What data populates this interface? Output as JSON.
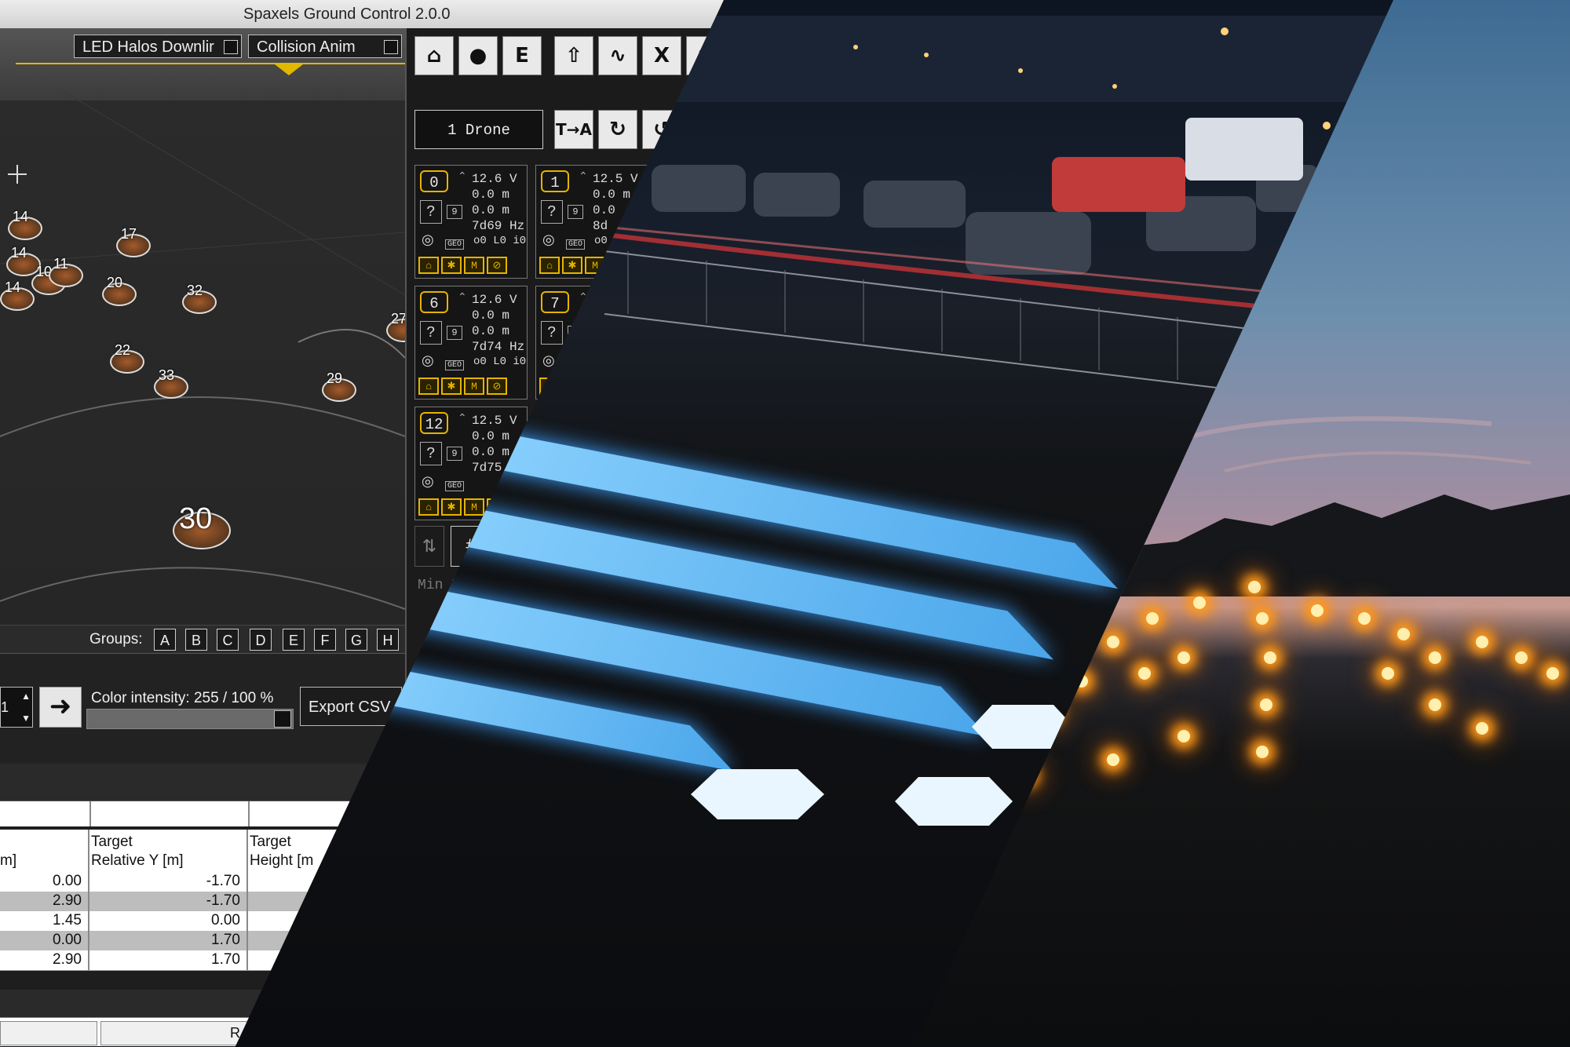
{
  "app": {
    "title": "Spaxels Ground Control 2.0.0"
  },
  "viewport": {
    "dropdown_led": "LED Halos Downlir",
    "dropdown_collision": "Collision Anim",
    "drone_labels": [
      "14",
      "14",
      "14",
      "10",
      "11",
      "17",
      "20",
      "32",
      "27",
      "22",
      "33",
      "29",
      "30"
    ]
  },
  "groups": {
    "label": "Groups:",
    "buttons": [
      "A",
      "B",
      "C",
      "D",
      "E",
      "F",
      "G",
      "H"
    ]
  },
  "controls": {
    "spin_value": "1",
    "color_intensity": "Color intensity: 255 / 100 %",
    "color_intensity_value": 1.0,
    "export_label": "Export CSV"
  },
  "table": {
    "headers": [
      "m]",
      "Target\nRelative Y [m]",
      "Target\nHeight [m"
    ],
    "rows": [
      [
        "0.00",
        "-1.70"
      ],
      [
        "2.90",
        "-1.70"
      ],
      [
        "1.45",
        "0.00"
      ],
      [
        "0.00",
        "1.70"
      ],
      [
        "2.90",
        "1.70"
      ]
    ]
  },
  "bottom_bar": {
    "right_label": "R"
  },
  "right_panel": {
    "top_tools": [
      "home-m-icon",
      "m-drones-icon",
      "E",
      "home-up-icon",
      "path-icon",
      "X",
      "wifi-icon"
    ],
    "tool_e": "E",
    "tool_x": "X",
    "drone_selector": "1 Drone",
    "mid_tools": [
      "T→A",
      "rotate-icon",
      "rotate2-icon"
    ],
    "tool_ta": "T→A",
    "cards": [
      {
        "id": "0",
        "voltage": "12.6 V",
        "alt": "0.0 m",
        "alt2": "0.0 m",
        "freq": "7d69 Hz",
        "code": "o0 L0 i0",
        "box": "9"
      },
      {
        "id": "1",
        "voltage": "12.5 V",
        "alt": "0.0 m",
        "alt2": "0.0",
        "freq": "8d",
        "code": "o0",
        "box": "9"
      },
      {
        "id": "6",
        "voltage": "12.6 V",
        "alt": "0.0 m",
        "alt2": "0.0 m",
        "freq": "7d74 Hz",
        "code": "o0 L0 i0",
        "box": "9"
      },
      {
        "id": "7",
        "voltage": "",
        "alt": "",
        "alt2": "",
        "freq": "",
        "code": "",
        "box": "9"
      },
      {
        "id": "12",
        "voltage": "12.5 V",
        "alt": "0.0 m",
        "alt2": "0.0 m",
        "freq": "7d75",
        "code": "",
        "box": "9"
      }
    ],
    "geo_label": "GEO",
    "card_buttons": [
      "home-icon",
      "star-icon",
      "M",
      "no-icon"
    ],
    "min_label": "Min P",
    "hash_label": "#"
  },
  "colors": {
    "accent_yellow": "#e6b300",
    "tile_blue": "#4aa6ea",
    "glow_orange": "#ff9a1a"
  }
}
